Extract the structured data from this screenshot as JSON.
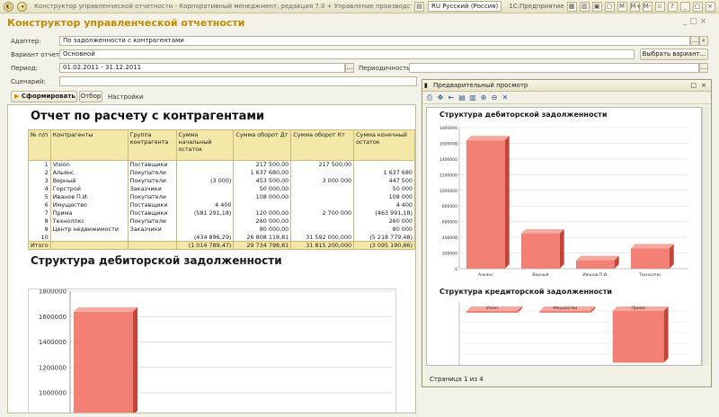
{
  "titlebar": {
    "title": "Конструктор управленческой отчетности - Корпоративный менеджмент, редакция 7.0 + Управление производственным п",
    "lang": "RU Русский (Россия)",
    "app": "1С:Предприятие",
    "buttons": [
      "M",
      "M+",
      "M-"
    ]
  },
  "window": {
    "title": "Конструктор управленческой отчетности",
    "controls": "_ □ ×"
  },
  "form": {
    "adapter_label": "Адаптер:",
    "adapter_value": "По задолженности с контрагентами",
    "variant_label": "Вариант отчета:",
    "variant_value": "Основной",
    "choose_variant": "Выбрать вариант...",
    "period_label": "Период:",
    "period_value": "01.02.2011 - 31.12.2011",
    "periodicity_label": "Периодичность:",
    "periodicity_value": "",
    "scenario_label": "Сценарий:",
    "scenario_value": "",
    "dots": "...",
    "run_button": "Сформировать",
    "filter_tab": "Отбор",
    "settings_tab": "Настройки"
  },
  "report": {
    "title": "Отчет по расчету с контрагентами",
    "headers": [
      "№ п/п",
      "Контрагенты",
      "Группа контрагента",
      "Сумма начальный остаток",
      "Сумма оборот Дт",
      "Сумма оборот Кт",
      "Сумма конечный остаток"
    ],
    "rows": [
      [
        "1",
        "Vision",
        "Поставщики",
        "",
        "217 500,00",
        "217 500,00",
        ""
      ],
      [
        "2",
        "Альянс",
        "Покупатели",
        "",
        "1 637 680,00",
        "",
        "1 637 680"
      ],
      [
        "3",
        "Верный",
        "Покупатели",
        "(3 000)",
        "453 500,00",
        "3 000 000",
        "447 500"
      ],
      [
        "4",
        "Горстрой",
        "Заказчики",
        "",
        "50 000,00",
        "",
        "50 000"
      ],
      [
        "5",
        "Иванов П.И.",
        "Покупатели",
        "",
        "108 000,00",
        "",
        "108 000"
      ],
      [
        "6",
        "Имущество",
        "Поставщики",
        "4 400",
        "",
        "",
        "4 400"
      ],
      [
        "7",
        "Прима",
        "Поставщики",
        "(581 291,18)",
        "120 000,00",
        "2 700 000",
        "(463 991,18)"
      ],
      [
        "8",
        "Технолпкс",
        "Покупатели",
        "",
        "260 000,00",
        "",
        "260 000"
      ],
      [
        "9",
        "Центр недвижимости",
        "Заказчики",
        "",
        "80 000,00",
        "",
        "80 000"
      ],
      [
        "10",
        "",
        "",
        "(434 896,29)",
        "26 808 118,81",
        "31 592 000,000",
        "(5 218 779,48)"
      ]
    ],
    "total": [
      "Итого",
      "",
      "",
      "(1 014 789,47)",
      "29 734 798,81",
      "31 815 200,000",
      "(3 095 190,66)"
    ],
    "subtitle": "Структура дебиторской задолженности"
  },
  "preview": {
    "title": "Предварительный просмотр",
    "chart1_title": "Структура дебиторской задолженности",
    "chart2_title": "Структура кредиторской задолженности",
    "status": "Страница 1 из 4"
  },
  "chart_data": [
    {
      "type": "bar",
      "title": "Структура дебиторской задолженности",
      "categories": [
        "Альянс"
      ],
      "values": [
        1637680
      ],
      "yticks": [
        "1000000",
        "1200000",
        "1400000",
        "1600000",
        "1800000"
      ],
      "ylim": [
        1000000,
        1800000
      ],
      "color": "#f28074"
    },
    {
      "type": "bar",
      "title": "Структура дебиторской задолженности",
      "categories": [
        "Альянс",
        "Верный",
        "Иванов П.И.",
        "Технолпкс"
      ],
      "values": [
        1637680,
        447500,
        108000,
        260000
      ],
      "yticks": [
        "0",
        "200000",
        "400000",
        "600000",
        "800000",
        "1000000",
        "1200000",
        "1400000",
        "1600000",
        "1800000"
      ],
      "ylim": [
        0,
        1800000
      ],
      "color": "#f28074"
    },
    {
      "type": "bar",
      "title": "Структура кредиторской задолженности",
      "categories": [
        "Vision",
        "Имущество",
        "Прима"
      ],
      "values": [
        0,
        0,
        -463991
      ],
      "color": "#f28074"
    }
  ]
}
